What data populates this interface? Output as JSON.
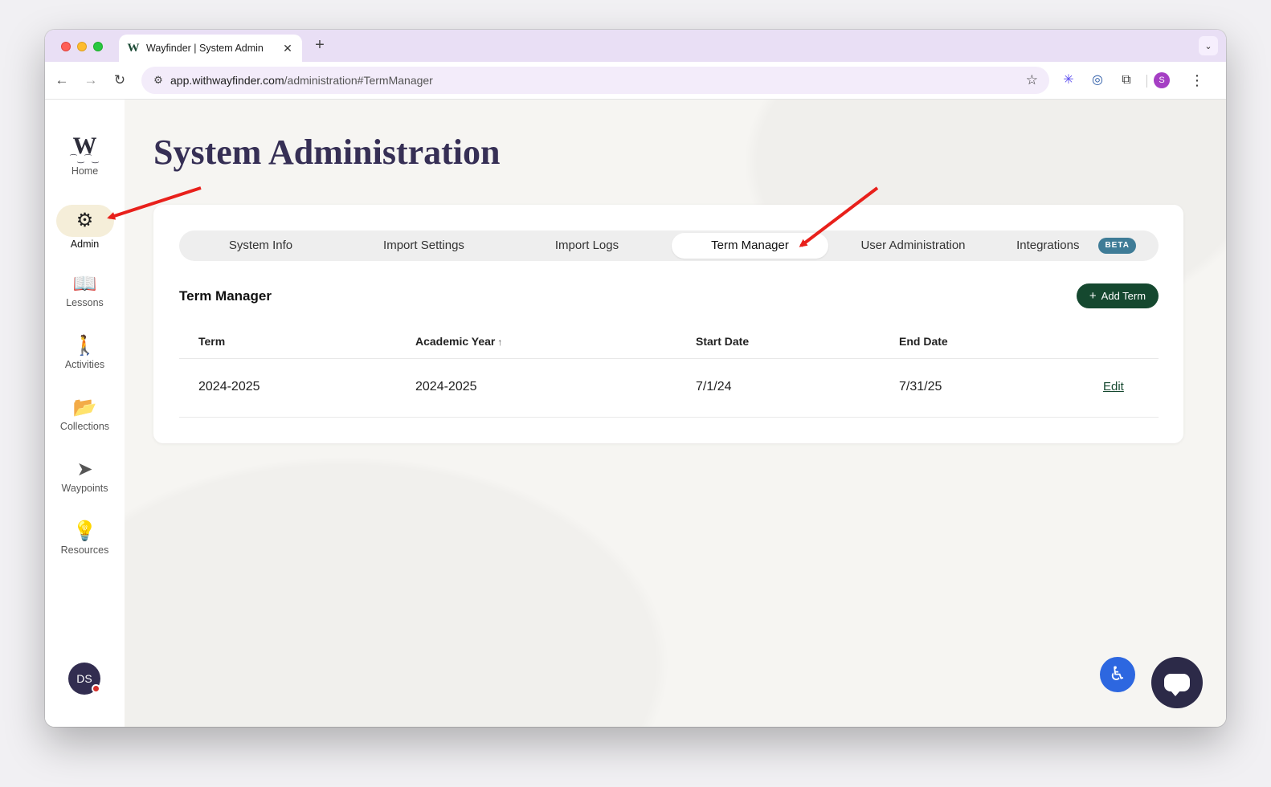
{
  "browser": {
    "tab_title": "Wayfinder | System Admin",
    "tab_favicon": "W",
    "tab_close": "✕",
    "new_tab": "+",
    "tab_menu": "⌄",
    "url_host": "app.withwayfinder.com",
    "url_path": "/administration#TermManager",
    "profile_initial": "S"
  },
  "sidebar": {
    "home_logo": "W",
    "items": [
      {
        "label": "Home",
        "icon": "wayfinder-logo-icon"
      },
      {
        "label": "Admin",
        "icon": "gear-icon",
        "active": true
      },
      {
        "label": "Lessons",
        "icon": "book-icon"
      },
      {
        "label": "Activities",
        "icon": "hiker-icon"
      },
      {
        "label": "Collections",
        "icon": "folder-icon"
      },
      {
        "label": "Waypoints",
        "icon": "navigation-arrow-icon"
      },
      {
        "label": "Resources",
        "icon": "lightbulb-icon"
      }
    ],
    "avatar_initials": "DS"
  },
  "page": {
    "title": "System Administration"
  },
  "tabs": [
    {
      "label": "System Info"
    },
    {
      "label": "Import Settings"
    },
    {
      "label": "Import Logs"
    },
    {
      "label": "Term Manager",
      "active": true
    },
    {
      "label": "User Administration"
    },
    {
      "label": "Integrations",
      "badge": "BETA"
    }
  ],
  "term_manager": {
    "section_title": "Term Manager",
    "add_button": "Add Term",
    "columns": [
      "Term",
      "Academic Year",
      "Start Date",
      "End Date"
    ],
    "sort_indicator": "↑",
    "rows": [
      {
        "term": "2024-2025",
        "academic_year": "2024-2025",
        "start_date": "7/1/24",
        "end_date": "7/31/25",
        "action": "Edit"
      }
    ]
  },
  "colors": {
    "accent_green": "#15482f",
    "title_purple": "#362f55",
    "annotation_arrow": "#e8201b"
  }
}
